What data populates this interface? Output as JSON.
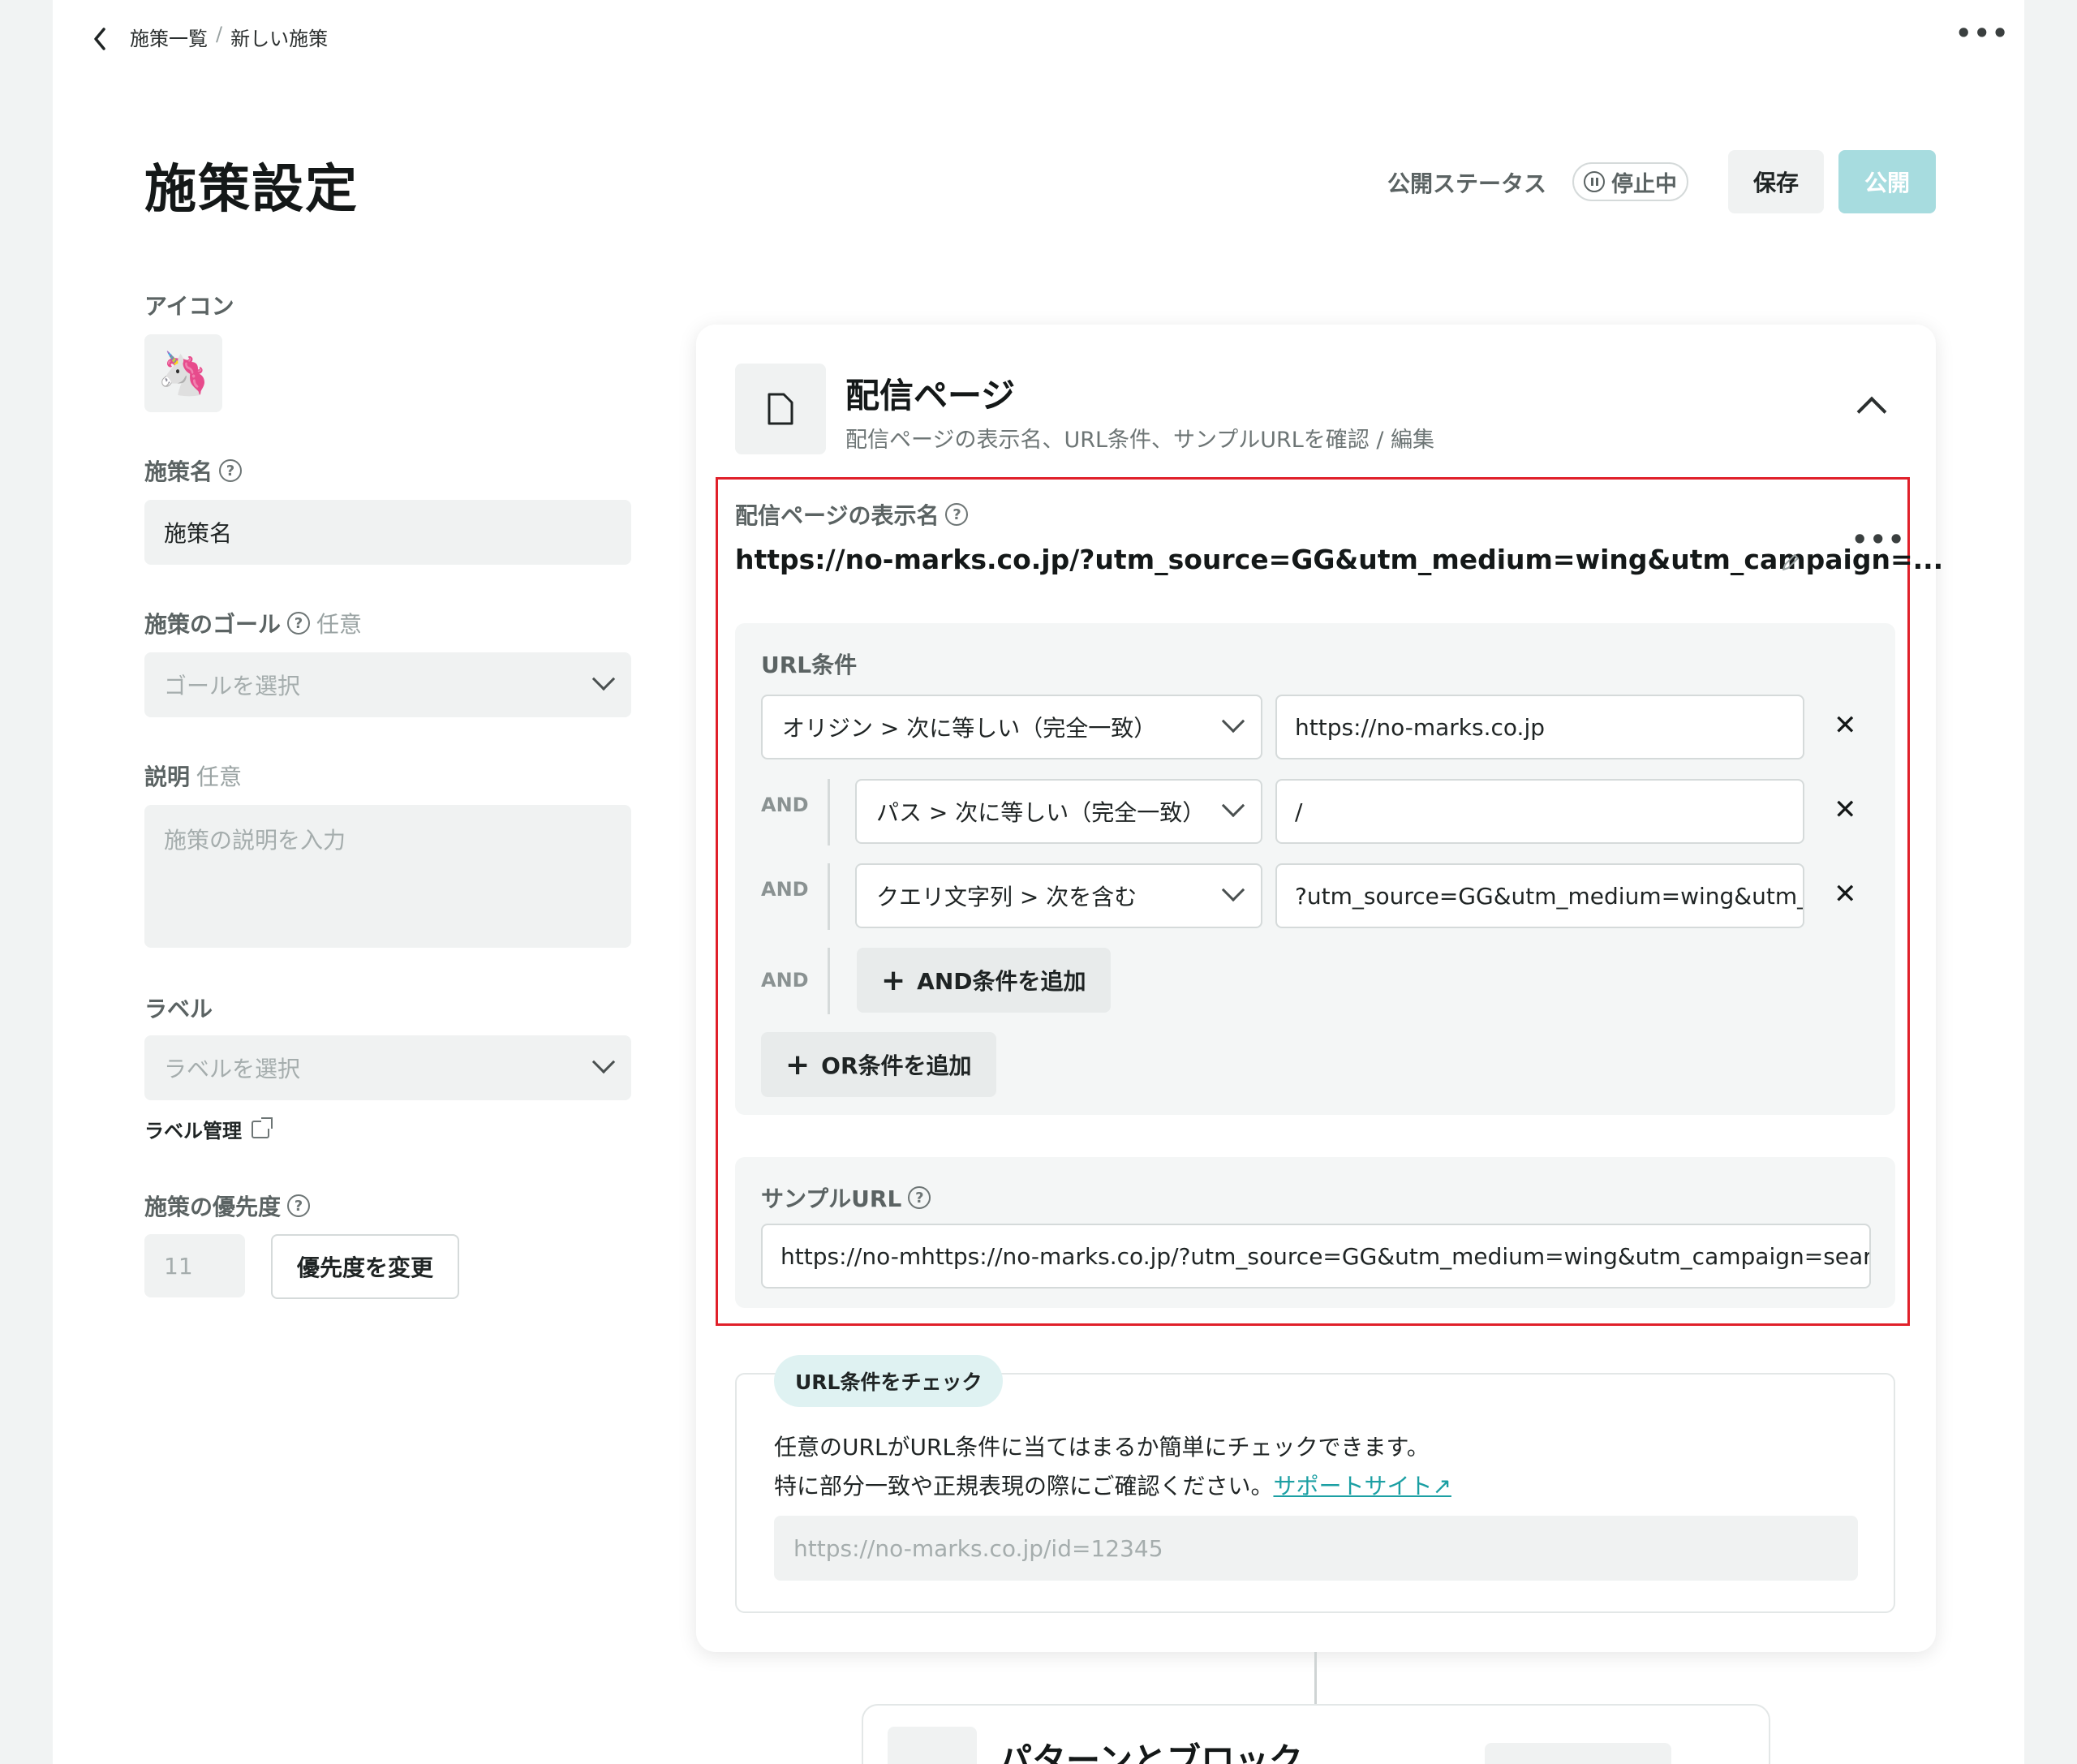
{
  "breadcrumb": {
    "parent": "施策一覧",
    "separator": "/",
    "current": "新しい施策"
  },
  "header": {
    "title": "施策設定",
    "status_label": "公開ステータス",
    "status_value": "停止中",
    "save_label": "保存",
    "publish_label": "公開"
  },
  "form": {
    "icon_label": "アイコン",
    "icon_emoji": "🦄",
    "name_label": "施策名",
    "name_value": "施策名",
    "goal_label": "施策のゴール",
    "goal_optional": "任意",
    "goal_placeholder": "ゴールを選択",
    "desc_label": "説明",
    "desc_optional": "任意",
    "desc_placeholder": "施策の説明を入力",
    "label_label": "ラベル",
    "label_placeholder": "ラベルを選択",
    "label_manage": "ラベル管理",
    "priority_label": "施策の優先度",
    "priority_value": "11",
    "priority_button": "優先度を変更"
  },
  "card": {
    "title": "配信ページ",
    "subtitle": "配信ページの表示名、URL条件、サンプルURLを確認 / 編集",
    "display_name_label": "配信ページの表示名",
    "display_name_value": "https://no-marks.co.jp/?utm_source=GG&utm_medium=wing&utm_campaign=...",
    "url_conditions_title": "URL条件",
    "and_label": "AND",
    "conditions": [
      {
        "type": "オリジン > 次に等しい（完全一致）",
        "value": "https://no-marks.co.jp"
      },
      {
        "type": "パス > 次に等しい（完全一致）",
        "value": "/"
      },
      {
        "type": "クエリ文字列 > 次を含む",
        "value": "?utm_source=GG&utm_medium=wing&utm_..."
      }
    ],
    "add_and_label": "AND条件を追加",
    "add_or_label": "OR条件を追加",
    "sample_url_label": "サンプルURL",
    "sample_url_value": "https://no-mhttps://no-marks.co.jp/?utm_source=GG&utm_medium=wing&utm_campaign=search..."
  },
  "check": {
    "pill": "URL条件をチェック",
    "line1": "任意のURLがURL条件に当てはまるか簡単にチェックできます。",
    "line2": "特に部分一致や正規表現の際にご確認ください。",
    "support_link": "サポートサイト↗",
    "placeholder": "https://no-marks.co.jp/id=12345"
  },
  "next_section": {
    "title": "パターンとブロック"
  },
  "colors": {
    "accent": "#1b9fa3",
    "publish_bg": "#a7dcdf",
    "highlight": "#e0202a"
  }
}
